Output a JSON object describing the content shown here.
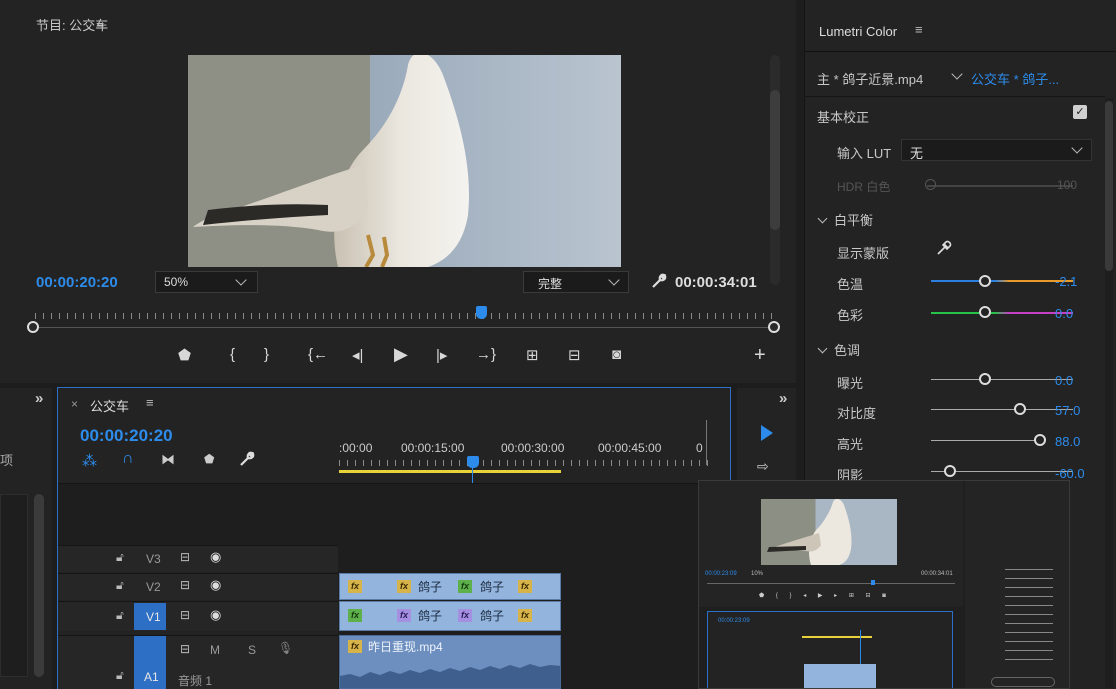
{
  "program_monitor": {
    "title": "节目: 公交车",
    "menu_icon": "hamburger-icon",
    "timecode_current": "00:00:20:20",
    "zoom": "50%",
    "quality": "完整",
    "timecode_duration": "00:00:34:01",
    "playhead_position": 0.59
  },
  "lumetri": {
    "title": "Lumetri Color",
    "source_label": "主 * 鸽子近景.mp4",
    "sequence_label": "公交车 * 鸽子...",
    "basic_correction": "基本校正",
    "input_lut_label": "输入 LUT",
    "input_lut_value": "无",
    "hdr_white_label": "HDR 白色",
    "hdr_white_value": "100",
    "white_balance": "白平衡",
    "show_mask": "显示蒙版",
    "temperature_label": "色温",
    "temperature_value": "-2.1",
    "tint_label": "色彩",
    "tint_value": "0.0",
    "tone": "色调",
    "exposure_label": "曝光",
    "exposure_value": "0.0",
    "contrast_label": "对比度",
    "contrast_value": "57.0",
    "highlights_label": "高光",
    "highlights_value": "88.0",
    "shadows_label": "阴影",
    "shadows_value": "-60.0"
  },
  "timeline": {
    "tab_title": "公交车",
    "timecode": "00:00:20:20",
    "ruler": [
      ":00:00",
      "00:00:15:00",
      "00:00:30:00",
      "00:00:45:00",
      "0"
    ],
    "tracks": {
      "v3": "V3",
      "v2": "V2",
      "v1": "V1",
      "a1": "A1",
      "a1_name": "音频 1",
      "m": "M",
      "s": "S"
    },
    "clips": {
      "v2_a": "鸽子",
      "v2_b": "鸽子",
      "v1_a": "鸽子",
      "v1_b": "鸽子",
      "a1": "昨日重现.mp4"
    }
  },
  "project_panel": {
    "partial_label": "项",
    "expand": "»"
  },
  "tools": {
    "expand": "»"
  },
  "thumbnail": {
    "timecode": "00:00:23:09",
    "duration": "00:00:34:01",
    "zoom": "10%"
  }
}
